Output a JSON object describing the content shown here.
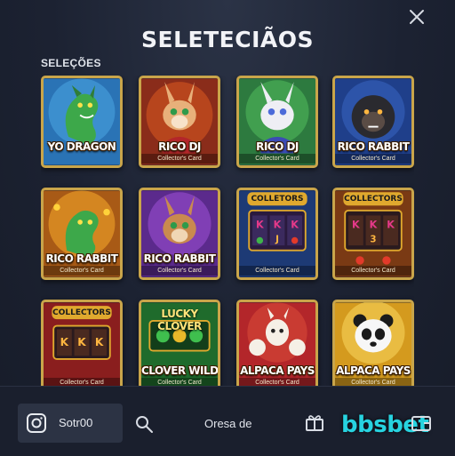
{
  "header": {
    "title": "SELETECIÃOS",
    "close_icon": "close-icon"
  },
  "section": {
    "label": "SELEÇÕES"
  },
  "cards": [
    {
      "name": "YO DRAGON",
      "subtitle": "",
      "art": "dragon-green"
    },
    {
      "name": "RICO DJ",
      "subtitle": "Collector's Card",
      "art": "rabbit-dj-orange"
    },
    {
      "name": "RICO DJ",
      "subtitle": "Collector's Card",
      "art": "rabbit-dj-white"
    },
    {
      "name": "RICO RABBIT",
      "subtitle": "Collector's Card",
      "art": "gorilla"
    },
    {
      "name": "RICO RABBIT",
      "subtitle": "Collector's Card",
      "art": "dragon-gold"
    },
    {
      "name": "RICO RABBIT",
      "subtitle": "Collector's Card",
      "art": "rabbit-purple"
    },
    {
      "name": "",
      "subtitle": "Collector's Card",
      "art": "slot-colletors",
      "badge": "COLLETORS"
    },
    {
      "name": "",
      "subtitle": "Collector's Card",
      "art": "slot-collectors",
      "badge": "COLLECTORS"
    },
    {
      "name": "",
      "subtitle": "Collector's Card",
      "art": "slot-red",
      "badge": "COLLECTORS"
    },
    {
      "name": "CLOVER WILD",
      "subtitle": "Collector's Card",
      "art": "clover",
      "badge": "LUCKY CLOVER"
    },
    {
      "name": "ALPACA PAYS",
      "subtitle": "Collector's Card",
      "art": "alpaca"
    },
    {
      "name": "ALPACA PAYS",
      "subtitle": "Collector's Card",
      "art": "panda"
    }
  ],
  "bottom_bar": {
    "username": "Sotr00",
    "menu_label": "Oresa de",
    "brand": "bbsbet",
    "icons": [
      "instagram-icon",
      "search-icon",
      "gift-icon",
      "wallet-icon"
    ]
  },
  "colors": {
    "accent": "#27d3e0",
    "card_border": "#c9a54a",
    "background": "#1c2232"
  }
}
